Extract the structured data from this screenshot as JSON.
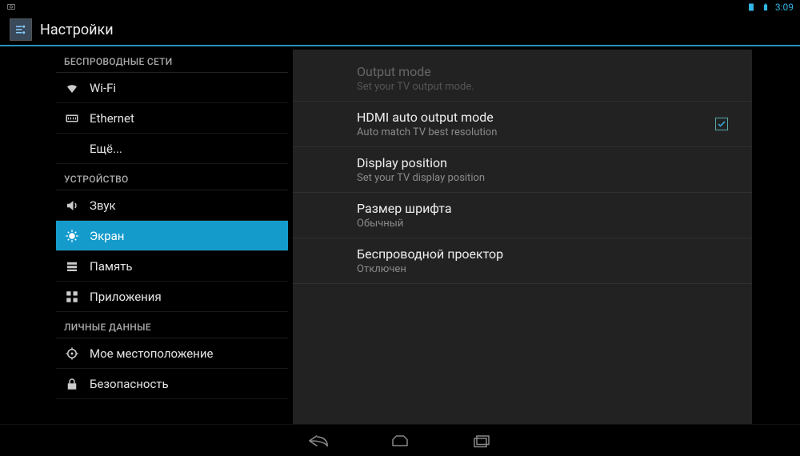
{
  "statusbar": {
    "clock": "3:09"
  },
  "header": {
    "title": "Настройки"
  },
  "sidebar": {
    "sections": [
      {
        "header": "БЕСПРОВОДНЫЕ СЕТИ",
        "items": [
          {
            "id": "wifi",
            "icon": "wifi-icon",
            "label": "Wi-Fi"
          },
          {
            "id": "ethernet",
            "icon": "ethernet-icon",
            "label": "Ethernet"
          },
          {
            "id": "more",
            "icon": "",
            "label": "Ещё...",
            "more": true
          }
        ]
      },
      {
        "header": "УСТРОЙСТВО",
        "items": [
          {
            "id": "sound",
            "icon": "sound-icon",
            "label": "Звук"
          },
          {
            "id": "display",
            "icon": "display-icon",
            "label": "Экран",
            "selected": true
          },
          {
            "id": "storage",
            "icon": "storage-icon",
            "label": "Память"
          },
          {
            "id": "apps",
            "icon": "apps-icon",
            "label": "Приложения"
          }
        ]
      },
      {
        "header": "ЛИЧНЫЕ ДАННЫЕ",
        "items": [
          {
            "id": "location",
            "icon": "location-icon",
            "label": "Мое местоположение"
          },
          {
            "id": "security",
            "icon": "lock-icon",
            "label": "Безопасность"
          }
        ]
      }
    ]
  },
  "detail": {
    "items": [
      {
        "id": "output-mode",
        "title": "Output mode",
        "sub": "Set your TV output mode.",
        "disabled": true
      },
      {
        "id": "hdmi-auto",
        "title": "HDMI auto output mode",
        "sub": "Auto match TV best resolution",
        "checkbox": true,
        "checked": true
      },
      {
        "id": "display-position",
        "title": "Display position",
        "sub": "Set your TV display position"
      },
      {
        "id": "font-size",
        "title": "Размер шрифта",
        "sub": "Обычный"
      },
      {
        "id": "wireless-display",
        "title": "Беспроводной проектор",
        "sub": "Отключен"
      }
    ]
  },
  "colors": {
    "accent": "#149bcc",
    "status": "#33b5e5"
  }
}
